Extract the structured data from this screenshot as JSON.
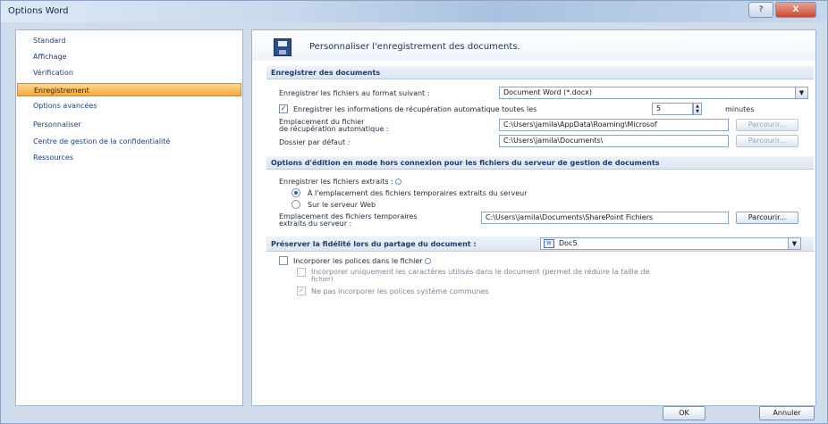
{
  "window": {
    "title": "Options Word",
    "help_label": "?",
    "close_label": "X"
  },
  "nav": {
    "items": [
      {
        "label": "Standard"
      },
      {
        "label": "Affichage"
      },
      {
        "label": "Vérification"
      },
      {
        "label": "Enregistrement",
        "selected": true
      },
      {
        "label": "Options avancées"
      },
      {
        "label": "Personnaliser"
      },
      {
        "label": "Centre de gestion de la confidentialité"
      },
      {
        "label": "Ressources"
      }
    ]
  },
  "banner": {
    "icon": "floppy-disk-icon",
    "title": "Personnaliser l'enregistrement des documents."
  },
  "save_section": {
    "title": "Enregistrer des documents",
    "format_label": "Enregistrer les fichiers au format suivant :",
    "format_value": "Document Word (*.docx)",
    "autorecover_checked": true,
    "autorecover_label": "Enregistrer les informations de récupération automatique toutes les",
    "autorecover_minutes": "5",
    "minutes_label": "minutes",
    "autorecover_location_label_line1": "Emplacement du fichier",
    "autorecover_location_label_line2": "de récupération automatique :",
    "autorecover_location_value": "C:\\Users\\jamila\\AppData\\Roaming\\Microsof",
    "default_folder_label": "Dossier par défaut :",
    "default_folder_value": "C:\\Users\\jamila\\Documents\\",
    "browse_label": "Parcourir..."
  },
  "offline_section": {
    "title": "Options d'édition en mode hors connexion pour les fichiers du serveur de gestion de documents",
    "save_checked_out_label": "Enregistrer les fichiers extraits :",
    "option_local_label": "À l'emplacement des fichiers temporaires extraits du serveur",
    "option_web_label": "Sur le serveur Web",
    "selected_option": "local",
    "drafts_location_label_line1": "Emplacement des fichiers temporaires",
    "drafts_location_label_line2": "extraits du serveur :",
    "drafts_location_value": "C:\\Users\\jamila\\Documents\\SharePoint Fichiers",
    "browse_label": "Parcourir..."
  },
  "fidelity_section": {
    "title": "Préserver la fidélité lors du partage du document :",
    "document_value": "Doc5",
    "embed_fonts_checked": false,
    "embed_fonts_label": "Incorporer les polices dans le fichier",
    "embed_used_chars_checked": false,
    "embed_used_chars_label_line1": "Incorporer uniquement les caractères utilisés dans le document (permet de réduire la taille de",
    "embed_used_chars_label_line2": "fichier)",
    "no_system_fonts_checked": true,
    "no_system_fonts_label": "Ne pas incorporer les polices système communes"
  },
  "footer": {
    "ok_label": "OK",
    "cancel_label": "Annuler"
  }
}
